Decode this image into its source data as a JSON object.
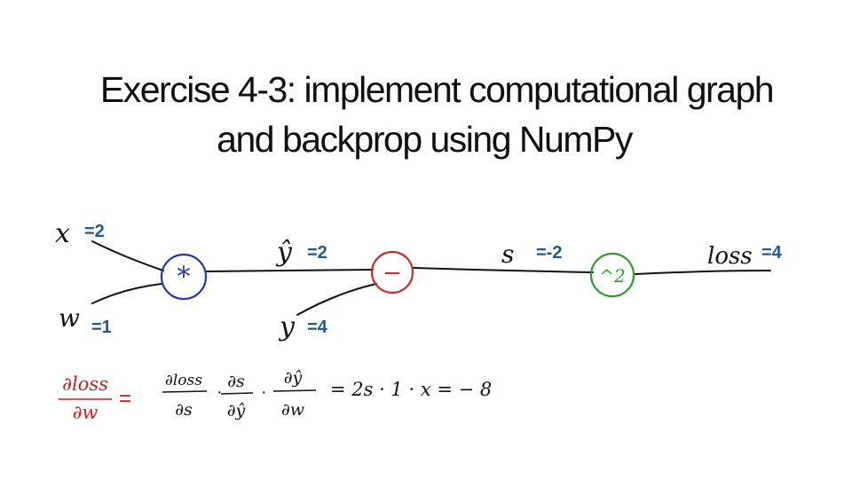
{
  "title": {
    "line1": "Exercise 4-3: implement computational graph",
    "line2": "and backprop using NumPy"
  },
  "colors": {
    "value_text": "#1f5a8a",
    "mul_node": "#2b35a8",
    "sub_node": "#c4302b",
    "sq_node": "#2f9a2f",
    "formula_red": "#c8201c",
    "ink": "#111111"
  },
  "graph": {
    "nodes": {
      "mul": {
        "symbol": "*"
      },
      "sub": {
        "symbol": "−"
      },
      "sq": {
        "symbol": "^2"
      }
    },
    "vars": {
      "x": {
        "label": "x",
        "value": "=2"
      },
      "w": {
        "label": "w",
        "value": "=1"
      },
      "yhat": {
        "label": "ŷ",
        "value": "=2"
      },
      "y": {
        "label": "y",
        "value": "=4"
      },
      "s": {
        "label": "s",
        "value": "=-2"
      },
      "loss": {
        "label": "loss",
        "value": "=4"
      }
    }
  },
  "formula": {
    "lhs_num": "∂loss",
    "lhs_den": "∂w",
    "eq": "=",
    "f1_num": "∂loss",
    "f1_den": "∂s",
    "f2_num": "∂s",
    "f2_den": "∂ŷ",
    "f3_num": "∂ŷ",
    "f3_den": "∂w",
    "dot": "·",
    "rhs": "= 2s · 1 · x  =  − 8"
  }
}
